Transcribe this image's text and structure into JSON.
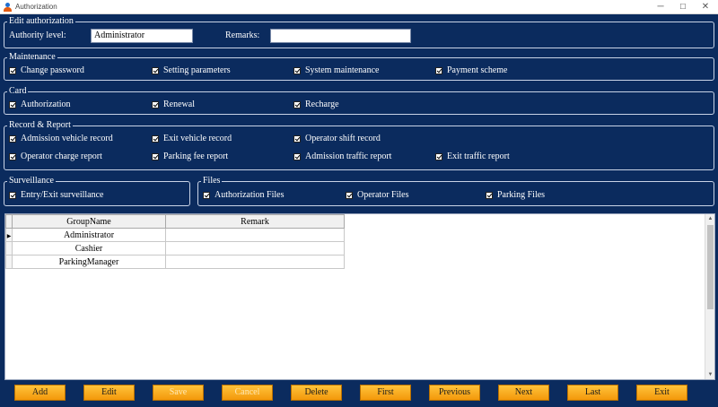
{
  "window": {
    "title": "Authorization",
    "controls": [
      "─",
      "☐",
      "✕"
    ]
  },
  "edit_authorization": {
    "title": "Edit authorization",
    "authority_label": "Authority level:",
    "authority_value": "Administrator",
    "remarks_label": "Remarks:",
    "remarks_value": ""
  },
  "maintenance": {
    "title": "Maintenance",
    "items": [
      {
        "label": "Change password",
        "checked": true
      },
      {
        "label": "Setting parameters",
        "checked": true
      },
      {
        "label": "System maintenance",
        "checked": true
      },
      {
        "label": "Payment scheme",
        "checked": true
      }
    ]
  },
  "card": {
    "title": "Card",
    "items": [
      {
        "label": "Authorization",
        "checked": true
      },
      {
        "label": "Renewal",
        "checked": true
      },
      {
        "label": "Recharge",
        "checked": true
      }
    ]
  },
  "record_report": {
    "title": "Record & Report",
    "items": [
      {
        "label": "Admission vehicle record",
        "checked": true
      },
      {
        "label": "Exit vehicle record",
        "checked": true
      },
      {
        "label": "Operator shift record",
        "checked": true
      },
      {
        "label": "Operator charge report",
        "checked": true
      },
      {
        "label": "Parking fee report",
        "checked": true
      },
      {
        "label": "Admission traffic report",
        "checked": true
      },
      {
        "label": "Exit traffic report",
        "checked": true
      }
    ]
  },
  "surveillance": {
    "title": "Surveillance",
    "items": [
      {
        "label": "Entry/Exit surveillance",
        "checked": true
      }
    ]
  },
  "files": {
    "title": "Files",
    "items": [
      {
        "label": "Authorization Files",
        "checked": true
      },
      {
        "label": "Operator Files",
        "checked": true
      },
      {
        "label": "Parking Files",
        "checked": true
      }
    ]
  },
  "grid": {
    "columns": [
      "GroupName",
      "Remark"
    ],
    "rows": [
      {
        "group": "Administrator",
        "remark": "",
        "current": true
      },
      {
        "group": "Cashier",
        "remark": ""
      },
      {
        "group": "ParkingManager",
        "remark": ""
      }
    ]
  },
  "buttons": [
    {
      "label": "Add",
      "enabled": true
    },
    {
      "label": "Edit",
      "enabled": true
    },
    {
      "label": "Save",
      "enabled": false
    },
    {
      "label": "Cancel",
      "enabled": false
    },
    {
      "label": "Delete",
      "enabled": true
    },
    {
      "label": "First",
      "enabled": true
    },
    {
      "label": "Previous",
      "enabled": true
    },
    {
      "label": "Next",
      "enabled": true
    },
    {
      "label": "Last",
      "enabled": true
    },
    {
      "label": "Exit",
      "enabled": true
    }
  ],
  "colors": {
    "panel": "#0b2b5e",
    "button": "#f7a51c",
    "border": "#c9d3e6"
  }
}
